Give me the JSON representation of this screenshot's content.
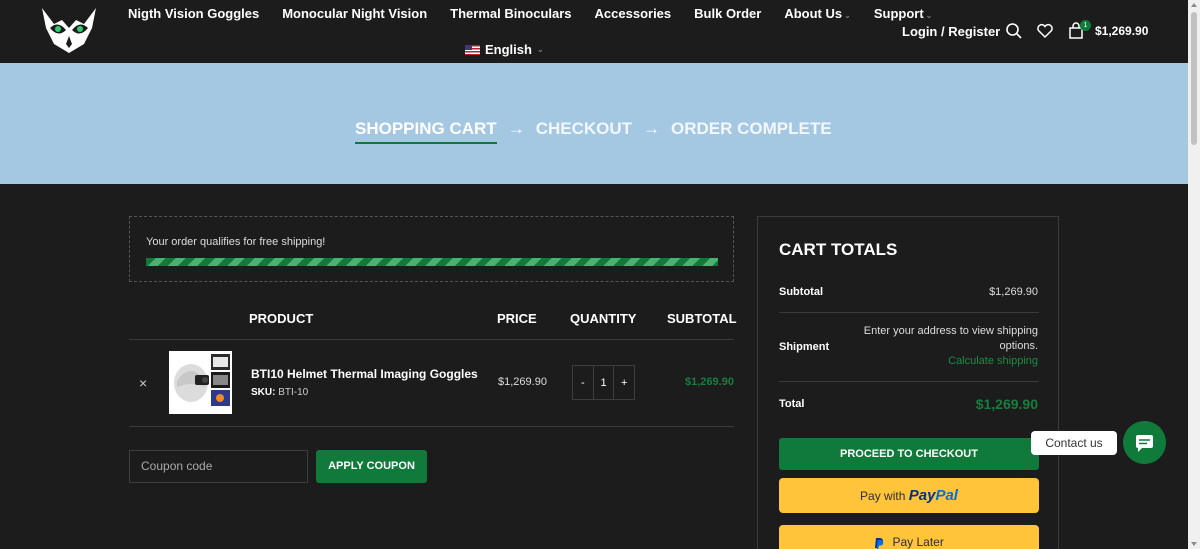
{
  "header": {
    "nav": [
      {
        "label": "Nigth Vision Goggles",
        "has_dropdown": false
      },
      {
        "label": "Monocular Night Vision",
        "has_dropdown": false
      },
      {
        "label": "Thermal Binoculars",
        "has_dropdown": false
      },
      {
        "label": "Accessories",
        "has_dropdown": false
      },
      {
        "label": "Bulk Order",
        "has_dropdown": false
      },
      {
        "label": "About Us",
        "has_dropdown": true
      },
      {
        "label": "Support",
        "has_dropdown": true
      }
    ],
    "language": "English",
    "login_label": "Login / Register",
    "cart_count": "1",
    "cart_total": "$1,269.90",
    "icons": [
      "owl-logo-icon",
      "search-icon",
      "heart-icon",
      "shopping-bag-icon",
      "us-flag-icon"
    ]
  },
  "steps": {
    "active": "SHOPPING CART",
    "arrow": "→",
    "checkout": "CHECKOUT",
    "complete": "ORDER COMPLETE"
  },
  "shipping_notice": {
    "text": "Your order qualifies for free shipping!",
    "progress_percent": 100
  },
  "cart_table": {
    "headers": {
      "product": "PRODUCT",
      "price": "PRICE",
      "quantity": "QUANTITY",
      "subtotal": "SUBTOTAL"
    },
    "items": [
      {
        "remove": "×",
        "name": "BTI10 Helmet Thermal Imaging Goggles",
        "sku_label": "SKU:",
        "sku": "BTI-10",
        "price": "$1,269.90",
        "qty_minus": "-",
        "quantity": "1",
        "qty_plus": "+",
        "subtotal": "$1,269.90"
      }
    ]
  },
  "coupon": {
    "placeholder": "Coupon code",
    "button": "APPLY COUPON"
  },
  "totals": {
    "title": "CART TOTALS",
    "subtotal_label": "Subtotal",
    "subtotal_value": "$1,269.90",
    "shipment_label": "Shipment",
    "shipment_text": "Enter your address to view shipping options.",
    "calc_link": "Calculate shipping",
    "total_label": "Total",
    "total_value": "$1,269.90",
    "checkout_button": "PROCEED TO CHECKOUT",
    "paypal_prefix": "Pay with",
    "paypal_brand_a": "Pay",
    "paypal_brand_b": "Pal",
    "paylater_label": "Pay Later"
  },
  "contact": {
    "label": "Contact us"
  },
  "colors": {
    "accent_green": "#0f7a3a",
    "hero_blue": "#a5c8e2",
    "paypal_yellow": "#ffc439"
  }
}
